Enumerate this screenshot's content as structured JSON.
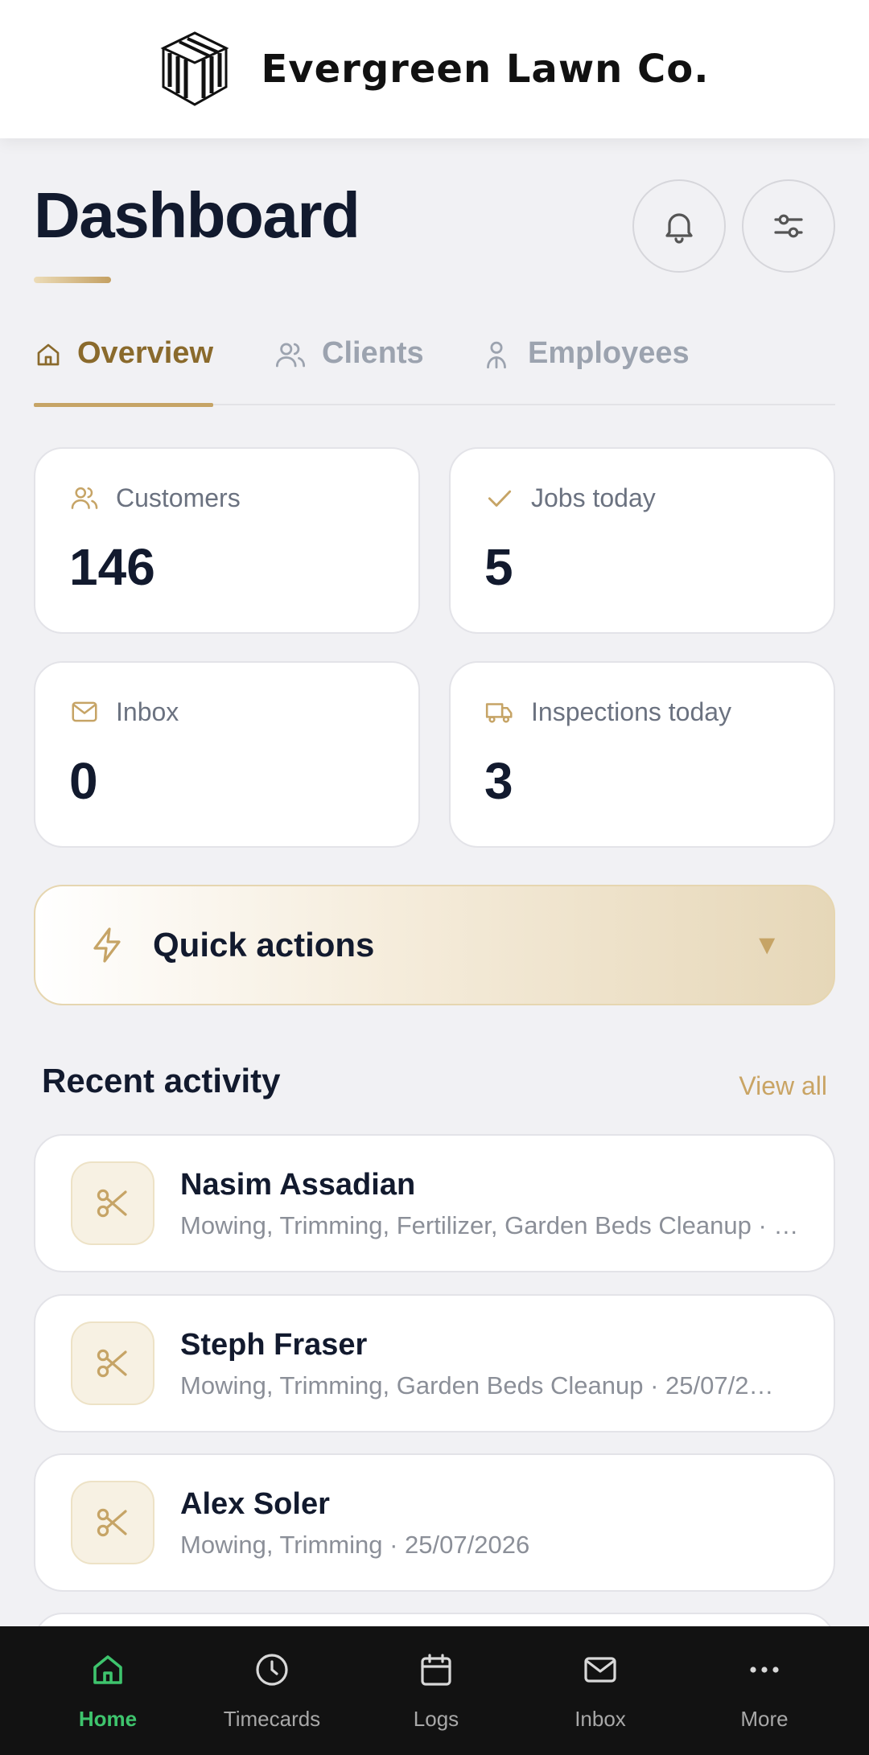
{
  "brand": {
    "name": "Evergreen Lawn Co.",
    "logo_icon": "striped-cube-logo"
  },
  "header": {
    "title": "Dashboard",
    "notifications_icon": "bell-icon",
    "settings_icon": "sliders-icon"
  },
  "tabs": [
    {
      "label": "Overview",
      "icon": "home-icon",
      "active": true
    },
    {
      "label": "Clients",
      "icon": "users-icon",
      "active": false
    },
    {
      "label": "Employees",
      "icon": "person-icon",
      "active": false
    }
  ],
  "stats": [
    {
      "label": "Customers",
      "value": "146",
      "icon": "users-icon"
    },
    {
      "label": "Jobs today",
      "value": "5",
      "icon": "check-icon"
    },
    {
      "label": "Inbox",
      "value": "0",
      "icon": "mail-icon"
    },
    {
      "label": "Inspections today",
      "value": "3",
      "icon": "truck-icon"
    }
  ],
  "quick_actions": {
    "label": "Quick actions",
    "icon": "bolt-icon",
    "caret": "▼"
  },
  "recent_activity": {
    "title": "Recent activity",
    "view_all": "View all",
    "items": [
      {
        "name": "Nasim Assadian",
        "description": "Mowing, Trimming, Fertilizer, Garden Beds Cleanup · …",
        "icon": "scissors-icon"
      },
      {
        "name": "Steph Fraser",
        "description": "Mowing, Trimming, Garden Beds Cleanup · 25/07/2…",
        "icon": "scissors-icon"
      },
      {
        "name": "Alex Soler",
        "description": "Mowing, Trimming · 25/07/2026",
        "icon": "scissors-icon"
      }
    ]
  },
  "bottom_nav": [
    {
      "label": "Home",
      "icon": "home-icon",
      "active": true
    },
    {
      "label": "Timecards",
      "icon": "clock-icon",
      "active": false
    },
    {
      "label": "Logs",
      "icon": "calendar-icon",
      "active": false
    },
    {
      "label": "Inbox",
      "icon": "mail-icon",
      "active": false
    },
    {
      "label": "More",
      "icon": "more-dots-icon",
      "active": false
    }
  ],
  "colors": {
    "accent_gold": "#c6a466",
    "accent_dark_gold": "#8a6a2c",
    "title_navy": "#121a2e",
    "nav_active_green": "#3ec46d",
    "page_background": "#f1f1f4"
  }
}
